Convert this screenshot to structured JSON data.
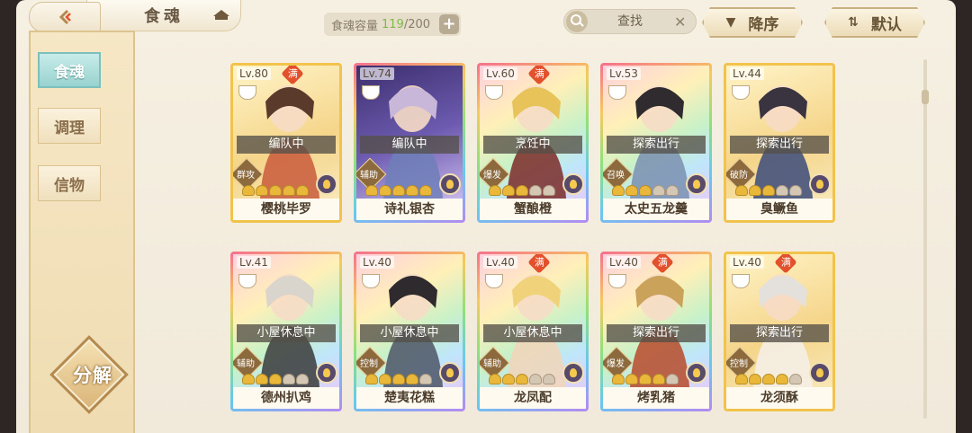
{
  "header": {
    "title": "食魂",
    "capacity_label": "食魂容量",
    "capacity_current": "119",
    "capacity_max": "/200",
    "plus": "+",
    "search_placeholder": "查找",
    "clear": "✕",
    "sort_order": "降序",
    "sort_default": "默认"
  },
  "sidebar": {
    "tabs": [
      {
        "label": "食魂",
        "active": true
      },
      {
        "label": "调理",
        "active": false
      },
      {
        "label": "信物",
        "active": false
      }
    ],
    "decompose": "分解"
  },
  "cards": [
    {
      "level": "Lv.80",
      "maxed": true,
      "max_label": "满",
      "status": "编队中",
      "role": "群攻",
      "stars": 5,
      "name": "樱桃毕罗",
      "frame": "gold"
    },
    {
      "level": "Lv.74",
      "maxed": false,
      "max_label": "",
      "status": "编队中",
      "role": "辅助",
      "stars": 5,
      "name": "诗礼银杏",
      "frame": "rainbow"
    },
    {
      "level": "Lv.60",
      "maxed": true,
      "max_label": "满",
      "status": "烹饪中",
      "role": "爆发",
      "stars": 3,
      "name": "蟹酿橙",
      "frame": "rainbow"
    },
    {
      "level": "Lv.53",
      "maxed": false,
      "max_label": "",
      "status": "探索出行",
      "role": "召唤",
      "stars": 3,
      "name": "太史五龙羹",
      "frame": "rainbow"
    },
    {
      "level": "Lv.44",
      "maxed": false,
      "max_label": "",
      "status": "探索出行",
      "role": "破防",
      "stars": 3,
      "name": "臭鳜鱼",
      "frame": "gold"
    },
    {
      "level": "Lv.41",
      "maxed": false,
      "max_label": "",
      "status": "小屋休息中",
      "role": "辅助",
      "stars": 3,
      "name": "德州扒鸡",
      "frame": "rainbow"
    },
    {
      "level": "Lv.40",
      "maxed": false,
      "max_label": "",
      "status": "小屋休息中",
      "role": "控制",
      "stars": 4,
      "name": "楚夷花糕",
      "frame": "rainbow"
    },
    {
      "level": "Lv.40",
      "maxed": true,
      "max_label": "满",
      "status": "小屋休息中",
      "role": "辅助",
      "stars": 3,
      "name": "龙凤配",
      "frame": "rainbow"
    },
    {
      "level": "Lv.40",
      "maxed": true,
      "max_label": "满",
      "status": "探索出行",
      "role": "爆发",
      "stars": 4,
      "name": "烤乳猪",
      "frame": "rainbow"
    },
    {
      "level": "Lv.40",
      "maxed": true,
      "max_label": "满",
      "status": "探索出行",
      "role": "控制",
      "stars": 4,
      "name": "龙须酥",
      "frame": "gold"
    }
  ]
}
